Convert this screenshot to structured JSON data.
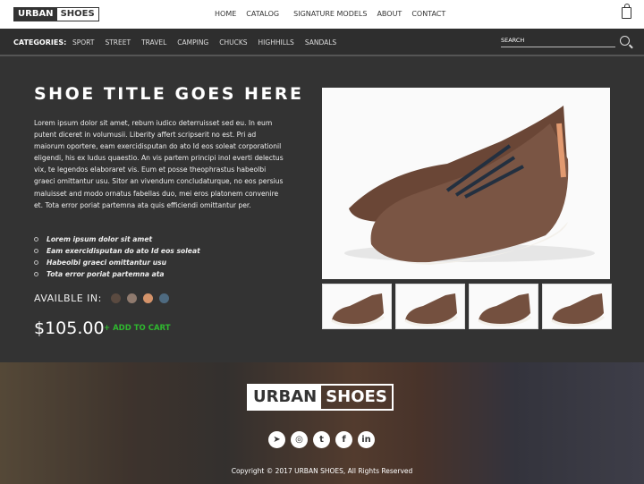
{
  "header": {
    "logo_a": "URBAN",
    "logo_b": "SHOES",
    "nav": [
      "HOME",
      "CATALOG",
      "SIGNATURE MODELS",
      "ABOUT",
      "CONTACT"
    ]
  },
  "categories": {
    "label": "CATEGORIES:",
    "items": [
      "SPORT",
      "STREET",
      "TRAVEL",
      "CAMPING",
      "CHUCKS",
      "HIGHHILLS",
      "SANDALS"
    ],
    "search_placeholder": "SEARCH"
  },
  "product": {
    "title": "SHOE TITLE GOES HERE",
    "description": "Lorem ipsum dolor sit amet, rebum iudico deterruisset sed eu. In eum putent diceret in volumusii. Liberity affert scripserit no est. Pri ad maiorum oportere, eam exercidisputan do ato Id eos soleat corporationil eligendi, his ex ludus quaestio. An vis partem principi inol everti delectus vix, te legendos elaboraret vis. Eum et posse theophrastus habeolbi graeci omittantur usu. Sitor an vivendum concludaturque, no eos persius maluisset and modo ornatus fabellas duo, mei eros platonem convenire et. Tota error poriat partemna ata quis efficiendi omittantur per.",
    "bullets": [
      "Lorem ipsum dolor sit amet",
      "Eam exercidisputan do ato Id eos soleat",
      "Habeolbi graeci omittantur usu",
      "Tota error poriat partemna ata"
    ],
    "available_label": "AVAILBLE IN:",
    "colors": [
      "#5a4a40",
      "#8f7a6e",
      "#d4936a",
      "#4e6a80"
    ],
    "price": "$105.00",
    "add_to_cart": "+ ADD TO CART"
  },
  "footer": {
    "logo_a": "URBAN",
    "logo_b": "SHOES",
    "social": [
      "telegram",
      "instagram",
      "twitter",
      "facebook",
      "linkedin"
    ],
    "copyright": "Copyright © 2017 URBAN SHOES, All Rights Reserved"
  }
}
